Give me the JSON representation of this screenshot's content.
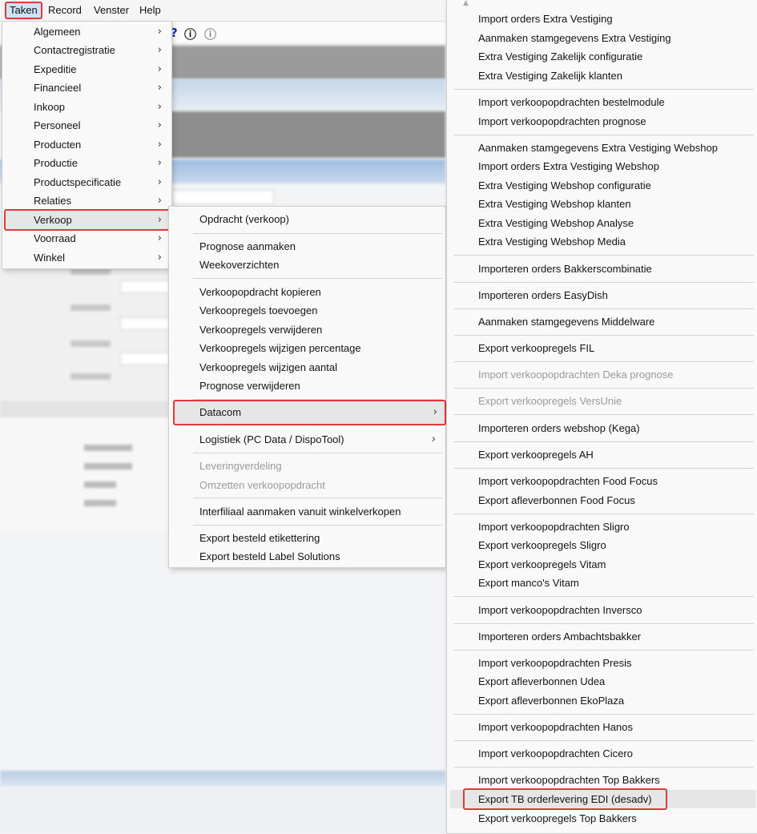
{
  "menubar": {
    "items": [
      "Taken",
      "Record",
      "Venster",
      "Help"
    ]
  },
  "toolbar": {
    "icons": [
      "help-icon",
      "info-icon",
      "hint-icon"
    ],
    "glyphs": [
      "?",
      "ⓘ",
      "ⓘ"
    ]
  },
  "taken_menu": {
    "items": [
      {
        "label": "Algemeen"
      },
      {
        "label": "Contactregistratie"
      },
      {
        "label": "Expeditie"
      },
      {
        "label": "Financieel"
      },
      {
        "label": "Inkoop"
      },
      {
        "label": "Personeel"
      },
      {
        "label": "Producten"
      },
      {
        "label": "Productie"
      },
      {
        "label": "Productspecificatie"
      },
      {
        "label": "Relaties"
      },
      {
        "label": "Verkoop"
      },
      {
        "label": "Voorraad"
      },
      {
        "label": "Winkel"
      }
    ],
    "chevron": "›"
  },
  "verkoop_menu": {
    "items": [
      {
        "label": "Opdracht (verkoop)"
      },
      {
        "label": "Prognose aanmaken"
      },
      {
        "label": "Weekoverzichten"
      },
      {
        "label": "Verkoopopdracht kopieren"
      },
      {
        "label": "Verkoopregels toevoegen"
      },
      {
        "label": "Verkoopregels verwijderen"
      },
      {
        "label": "Verkoopregels wijzigen percentage"
      },
      {
        "label": "Verkoopregels wijzigen aantal"
      },
      {
        "label": "Prognose verwijderen"
      },
      {
        "label": "Datacom"
      },
      {
        "label": "Logistiek (PC Data / DispoTool)"
      },
      {
        "label": "Leveringverdeling"
      },
      {
        "label": "Omzetten verkoopopdracht"
      },
      {
        "label": "Interfiliaal aanmaken vanuit winkelverkopen"
      },
      {
        "label": "Export besteld etikettering"
      },
      {
        "label": "Export besteld Label Solutions"
      }
    ]
  },
  "datacom_menu": {
    "items": [
      {
        "label": "Import orders Extra Vestiging"
      },
      {
        "label": "Aanmaken stamgegevens Extra Vestiging"
      },
      {
        "label": "Extra Vestiging Zakelijk configuratie"
      },
      {
        "label": "Extra Vestiging Zakelijk klanten"
      },
      {
        "label": "Import verkoopopdrachten bestelmodule"
      },
      {
        "label": "Import verkoopopdrachten prognose"
      },
      {
        "label": "Aanmaken stamgegevens Extra Vestiging Webshop"
      },
      {
        "label": "Import orders Extra Vestiging Webshop"
      },
      {
        "label": "Extra Vestiging Webshop configuratie"
      },
      {
        "label": "Extra Vestiging Webshop klanten"
      },
      {
        "label": "Extra Vestiging Webshop Analyse"
      },
      {
        "label": "Extra Vestiging Webshop Media"
      },
      {
        "label": "Importeren orders Bakkerscombinatie"
      },
      {
        "label": "Importeren orders EasyDish"
      },
      {
        "label": "Aanmaken stamgegevens Middelware"
      },
      {
        "label": "Export verkoopregels FIL"
      },
      {
        "label": "Import verkoopopdrachten Deka prognose"
      },
      {
        "label": "Export verkoopregels VersUnie"
      },
      {
        "label": "Importeren orders webshop (Kega)"
      },
      {
        "label": "Export verkoopregels AH"
      },
      {
        "label": "Import verkoopopdrachten Food Focus"
      },
      {
        "label": "Export afleverbonnen Food Focus"
      },
      {
        "label": "Import verkoopopdrachten Sligro"
      },
      {
        "label": "Export verkoopregels Sligro"
      },
      {
        "label": "Export verkoopregels Vitam"
      },
      {
        "label": "Export manco's Vitam"
      },
      {
        "label": "Import verkoopopdrachten Inversco"
      },
      {
        "label": "Importeren orders Ambachtsbakker"
      },
      {
        "label": "Import verkoopopdrachten Presis"
      },
      {
        "label": "Export afleverbonnen Udea"
      },
      {
        "label": "Export afleverbonnen EkoPlaza"
      },
      {
        "label": "Import verkoopopdrachten Hanos"
      },
      {
        "label": "Import verkoopopdrachten Cicero"
      },
      {
        "label": "Import verkoopopdrachten Top Bakkers"
      },
      {
        "label": "Export TB orderlevering EDI (desadv)"
      },
      {
        "label": "Export verkoopregels Top Bakkers"
      }
    ],
    "scroll_glyph": "▲"
  },
  "colors": {
    "highlight": "#e0383b",
    "selected_bg": "#e6e6e6",
    "disabled_text": "#9a9a9a"
  }
}
